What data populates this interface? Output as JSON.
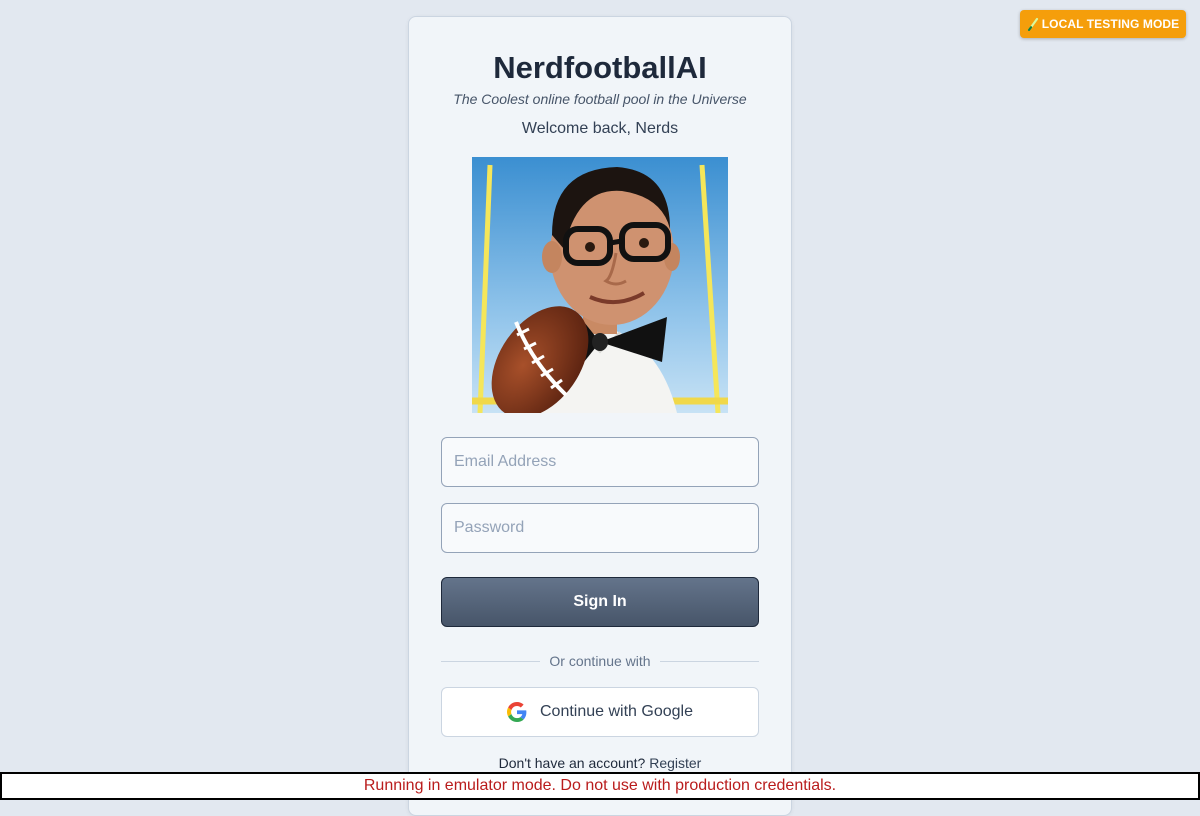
{
  "badge": {
    "icon": "pencil-icon",
    "label": "LOCAL TESTING MODE",
    "color": "#f59e0b"
  },
  "header": {
    "title": "NerdfootballAI",
    "tagline": "The Coolest online football pool in the Universe",
    "welcome": "Welcome back, Nerds"
  },
  "hero_image": {
    "alt": "Nerd with glasses and bow tie holding a football in front of goal posts"
  },
  "form": {
    "email_placeholder": "Email Address",
    "password_placeholder": "Password",
    "signin_label": "Sign In",
    "divider_text": "Or continue with",
    "google_label": "Continue with Google",
    "google_icon": "google-icon"
  },
  "register": {
    "prompt": "Don't have an account?",
    "link": "Register"
  },
  "banner": {
    "text": "Running in emulator mode. Do not use with production credentials.",
    "color": "#b91c1c"
  },
  "colors": {
    "background": "#e2e8f0",
    "card": "#f1f5f9",
    "primary_button": "#475569"
  }
}
